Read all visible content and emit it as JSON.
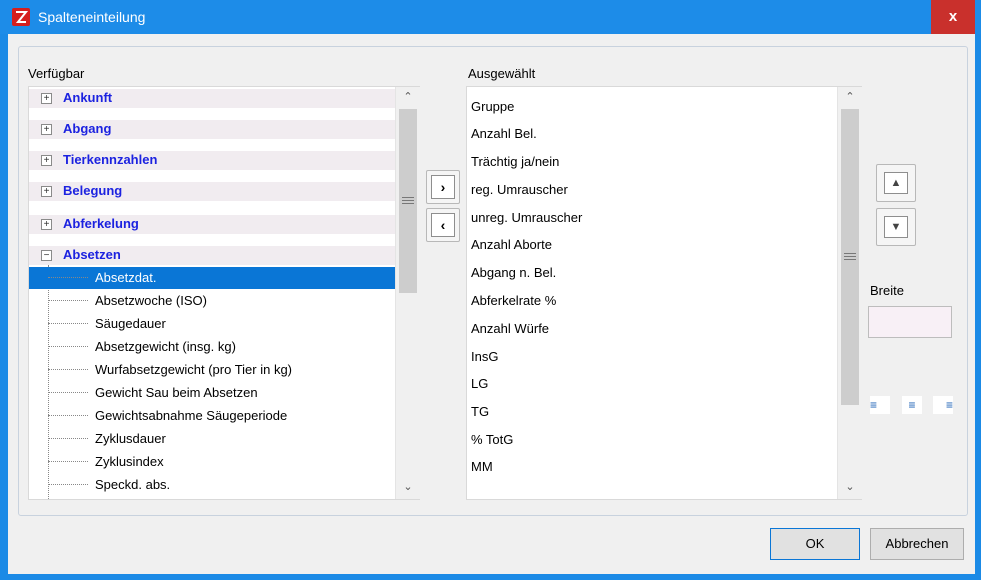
{
  "window": {
    "title": "Spalteneinteilung",
    "close_label": "x"
  },
  "available": {
    "label": "Verfügbar",
    "categories": [
      {
        "label": "Ankunft",
        "expanded": false
      },
      {
        "label": "Abgang",
        "expanded": false
      },
      {
        "label": "Tierkennzahlen",
        "expanded": false
      },
      {
        "label": "Belegung",
        "expanded": false
      },
      {
        "label": "Abferkelung",
        "expanded": false
      },
      {
        "label": "Absetzen",
        "expanded": true
      }
    ],
    "expand_glyph": "+",
    "collapse_glyph": "−",
    "absetzen_items": [
      "Absetzdat.",
      "Absetzwoche (ISO)",
      "Säugedauer",
      "Absetzgewicht (insg. kg)",
      "Wurfabsetzgewicht (pro Tier in kg)",
      "Gewicht Sau beim Absetzen",
      "Gewichtsabnahme Säugeperiode",
      "Zyklusdauer",
      "Zyklusindex",
      "Speckd. abs."
    ],
    "selected_item": "Absetzdat."
  },
  "transfer": {
    "add_glyph": "›",
    "remove_glyph": "‹"
  },
  "selected": {
    "label": "Ausgewählt",
    "items": [
      "Gruppe",
      "Anzahl Bel.",
      "Trächtig ja/nein",
      "reg. Umrauscher",
      "unreg. Umrauscher",
      "Anzahl Aborte",
      "Abgang n. Bel.",
      "Abferkelrate %",
      "Anzahl Würfe",
      "InsG",
      "LG",
      "TG",
      "% TotG",
      "MM"
    ]
  },
  "order": {
    "up_glyph": "▲",
    "down_glyph": "▼"
  },
  "width": {
    "label": "Breite",
    "value": ""
  },
  "alignment": {
    "left_glyph": "≡",
    "center_glyph": "≡",
    "right_glyph": "≡"
  },
  "scroll": {
    "up_glyph": "⌃",
    "down_glyph": "⌄"
  },
  "buttons": {
    "ok": "OK",
    "cancel": "Abbrechen"
  },
  "colors": {
    "titlebar": "#1d8ce8",
    "category_text": "#1c22e0",
    "selection": "#0a76d6",
    "close": "#c9302c"
  }
}
